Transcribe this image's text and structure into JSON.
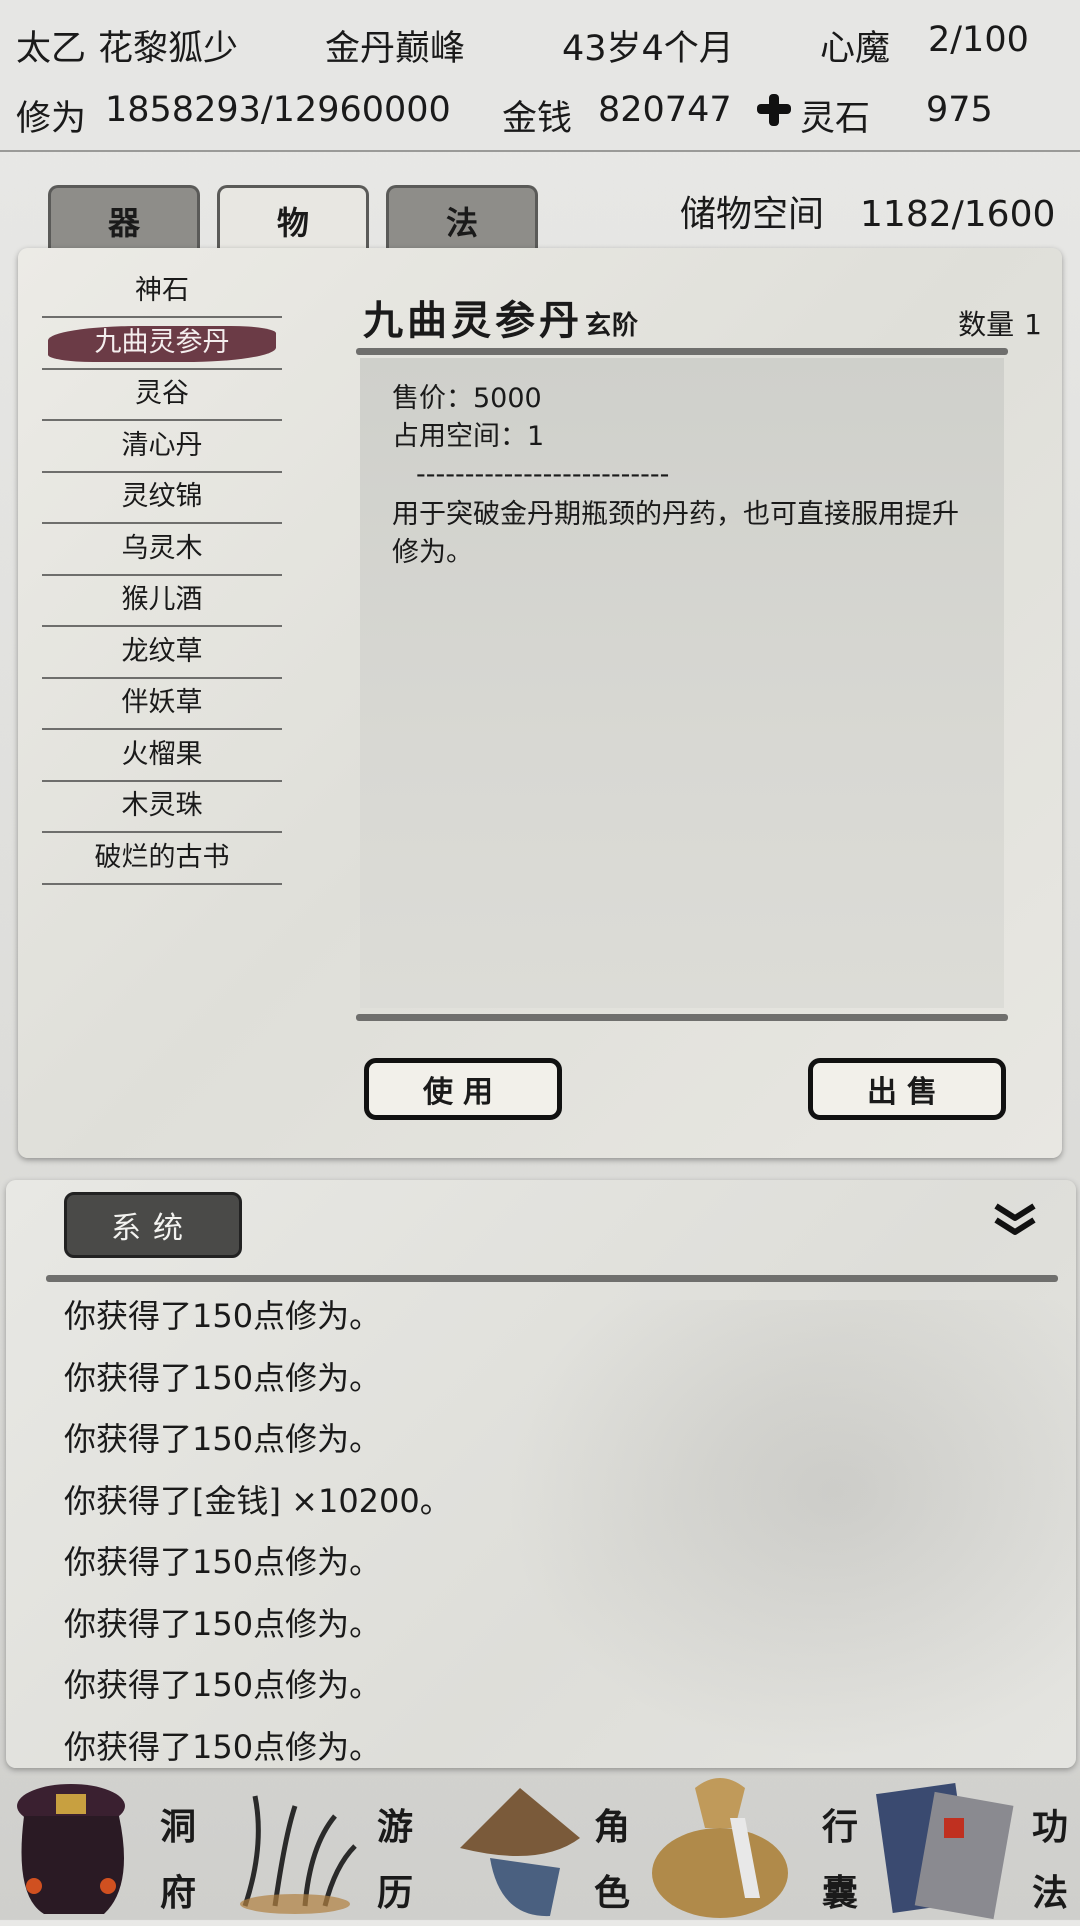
{
  "header": {
    "sect": "太乙",
    "name": "花黎狐少",
    "realm": "金丹巅峰",
    "age": "43岁4个月",
    "demon_label": "心魔",
    "demon_value": "2/100",
    "cultivation_label": "修为",
    "cultivation_value": "1858293/12960000",
    "money_label": "金钱",
    "money_value": "820747",
    "spirit_stone_icon": "ink-cross-icon",
    "spirit_stone_label": "灵石",
    "spirit_stone_value": "975"
  },
  "tabs": [
    {
      "label": "器",
      "active": false
    },
    {
      "label": "物",
      "active": true
    },
    {
      "label": "法",
      "active": false
    }
  ],
  "storage": {
    "label": "储物空间",
    "value": "1182/1600"
  },
  "items": [
    "神石",
    "九曲灵参丹",
    "灵谷",
    "清心丹",
    "灵纹锦",
    "乌灵木",
    "猴儿酒",
    "龙纹草",
    "伴妖草",
    "火榴果",
    "木灵珠",
    "破烂的古书"
  ],
  "selected_index": 1,
  "detail": {
    "title": "九曲灵参丹",
    "grade": "玄阶",
    "qty_label": "数量",
    "qty_value": "1",
    "price": "售价：5000",
    "space": "占用空间：1",
    "divider": "--------------------------",
    "description": "用于突破金丹期瓶颈的丹药，也可直接服用提升修为。",
    "use_label": "使用",
    "sell_label": "出售"
  },
  "log": {
    "tab_label": "系统",
    "collapse_icon": "double-chevron-down-icon",
    "lines": [
      "你获得了150点修为。",
      "你获得了150点修为。",
      "你获得了150点修为。",
      "你获得了[金钱] ×10200。",
      "你获得了150点修为。",
      "你获得了150点修为。",
      "你获得了150点修为。",
      "你获得了150点修为。"
    ]
  },
  "nav": [
    {
      "label": "洞府",
      "icon": "cave-lantern-icon"
    },
    {
      "label": "游历",
      "icon": "grass-bonfire-icon"
    },
    {
      "label": "角色",
      "icon": "straw-hat-icon"
    },
    {
      "label": "行囊",
      "icon": "cloth-bag-icon"
    },
    {
      "label": "功法",
      "icon": "scroll-books-icon"
    }
  ],
  "colors": {
    "selected_item": "#6b3b46",
    "tab_inactive": "#8e8d89",
    "tab_active": "#e8e7e2"
  }
}
